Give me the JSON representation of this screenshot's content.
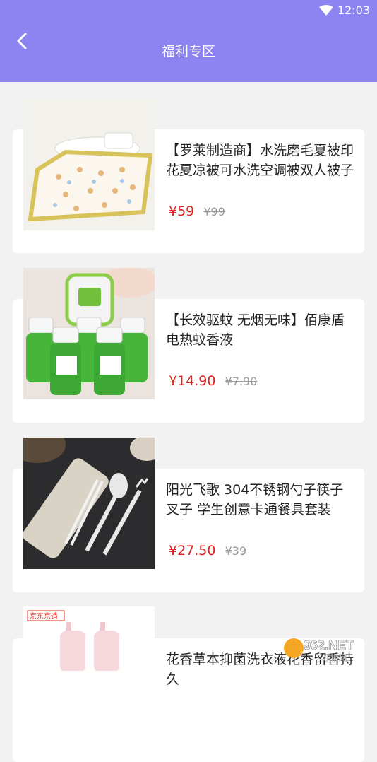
{
  "status": {
    "time": "12:03"
  },
  "header": {
    "title": "福利专区"
  },
  "products": [
    {
      "title": "【罗莱制造商】水洗磨毛夏被印花夏凉被可水洗空调被双人被子",
      "price": "¥59",
      "original_price": "¥99"
    },
    {
      "title": "【长效驱蚊 无烟无味】佰康盾电热蚊香液",
      "price": "¥14.90",
      "original_price": "¥7.90"
    },
    {
      "title": "阳光飞歌 304不锈钢勺子筷子叉子 学生创意卡通餐具套装",
      "price": "¥27.50",
      "original_price": "¥39"
    },
    {
      "title": "花香草本抑菌洗衣液花香留香持久",
      "price": "",
      "original_price": ""
    }
  ],
  "badges": {
    "jd": "京东京造",
    "watermark": "962.NET",
    "watermark_sub": "乐游网"
  },
  "colors": {
    "header": "#8e84f1",
    "price": "#e51d1d"
  }
}
